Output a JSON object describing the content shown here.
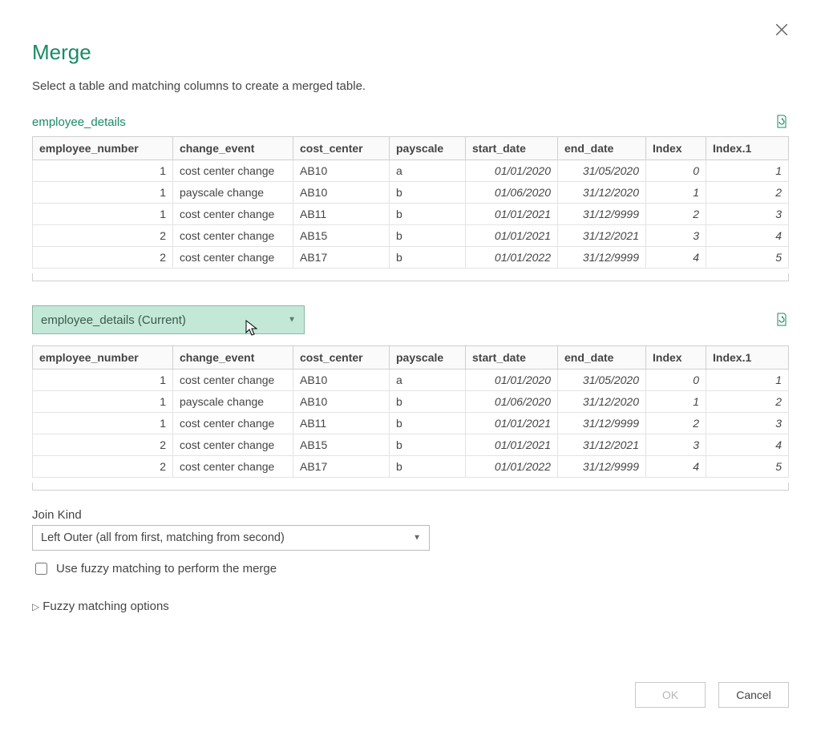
{
  "dialog": {
    "title": "Merge",
    "subtitle": "Select a table and matching columns to create a merged table."
  },
  "table1": {
    "name": "employee_details",
    "columns": [
      "employee_number",
      "change_event",
      "cost_center",
      "payscale",
      "start_date",
      "end_date",
      "Index",
      "Index.1"
    ],
    "rows": [
      {
        "employee_number": "1",
        "change_event": "cost center change",
        "cost_center": "AB10",
        "payscale": "a",
        "start_date": "01/01/2020",
        "end_date": "31/05/2020",
        "Index": "0",
        "Index1": "1"
      },
      {
        "employee_number": "1",
        "change_event": "payscale change",
        "cost_center": "AB10",
        "payscale": "b",
        "start_date": "01/06/2020",
        "end_date": "31/12/2020",
        "Index": "1",
        "Index1": "2"
      },
      {
        "employee_number": "1",
        "change_event": "cost center change",
        "cost_center": "AB11",
        "payscale": "b",
        "start_date": "01/01/2021",
        "end_date": "31/12/9999",
        "Index": "2",
        "Index1": "3"
      },
      {
        "employee_number": "2",
        "change_event": "cost center change",
        "cost_center": "AB15",
        "payscale": "b",
        "start_date": "01/01/2021",
        "end_date": "31/12/2021",
        "Index": "3",
        "Index1": "4"
      },
      {
        "employee_number": "2",
        "change_event": "cost center change",
        "cost_center": "AB17",
        "payscale": "b",
        "start_date": "01/01/2022",
        "end_date": "31/12/9999",
        "Index": "4",
        "Index1": "5"
      }
    ]
  },
  "table2": {
    "selector_label": "employee_details (Current)",
    "columns": [
      "employee_number",
      "change_event",
      "cost_center",
      "payscale",
      "start_date",
      "end_date",
      "Index",
      "Index.1"
    ],
    "rows": [
      {
        "employee_number": "1",
        "change_event": "cost center change",
        "cost_center": "AB10",
        "payscale": "a",
        "start_date": "01/01/2020",
        "end_date": "31/05/2020",
        "Index": "0",
        "Index1": "1"
      },
      {
        "employee_number": "1",
        "change_event": "payscale change",
        "cost_center": "AB10",
        "payscale": "b",
        "start_date": "01/06/2020",
        "end_date": "31/12/2020",
        "Index": "1",
        "Index1": "2"
      },
      {
        "employee_number": "1",
        "change_event": "cost center change",
        "cost_center": "AB11",
        "payscale": "b",
        "start_date": "01/01/2021",
        "end_date": "31/12/9999",
        "Index": "2",
        "Index1": "3"
      },
      {
        "employee_number": "2",
        "change_event": "cost center change",
        "cost_center": "AB15",
        "payscale": "b",
        "start_date": "01/01/2021",
        "end_date": "31/12/2021",
        "Index": "3",
        "Index1": "4"
      },
      {
        "employee_number": "2",
        "change_event": "cost center change",
        "cost_center": "AB17",
        "payscale": "b",
        "start_date": "01/01/2022",
        "end_date": "31/12/9999",
        "Index": "4",
        "Index1": "5"
      }
    ]
  },
  "join": {
    "label": "Join Kind",
    "selected": "Left Outer (all from first, matching from second)"
  },
  "fuzzy": {
    "checkbox_label": "Use fuzzy matching to perform the merge",
    "expander_label": "Fuzzy matching options"
  },
  "buttons": {
    "ok": "OK",
    "cancel": "Cancel"
  }
}
